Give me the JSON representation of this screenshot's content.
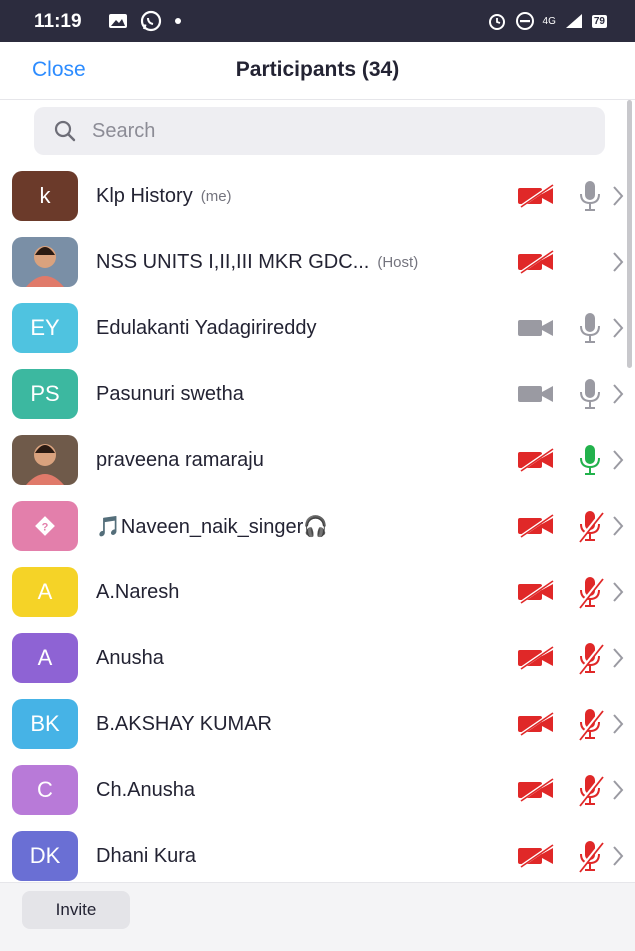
{
  "status_bar": {
    "time": "11:19",
    "signal": "4G",
    "battery": "79"
  },
  "header": {
    "close_label": "Close",
    "title": "Participants (34)"
  },
  "search": {
    "placeholder": "Search"
  },
  "participants": [
    {
      "initials": "k",
      "avatar_color": "#6b3a2a",
      "photo": false,
      "name": "Klp History",
      "suffix": "(me)",
      "video": "off",
      "audio": "on"
    },
    {
      "initials": "",
      "avatar_color": "#7a8fa6",
      "photo": true,
      "name": "NSS UNITS I,II,III MKR GDC...",
      "suffix": "(Host)",
      "video": "off",
      "audio": "none"
    },
    {
      "initials": "EY",
      "avatar_color": "#4fc3e0",
      "photo": false,
      "name": "Edulakanti Yadagirireddy",
      "suffix": "",
      "video": "on",
      "audio": "on"
    },
    {
      "initials": "PS",
      "avatar_color": "#3cb8a0",
      "photo": false,
      "name": "Pasunuri swetha",
      "suffix": "",
      "video": "on",
      "audio": "on"
    },
    {
      "initials": "",
      "avatar_color": "#6f5a4a",
      "photo": true,
      "name": "praveena ramaraju",
      "suffix": "",
      "video": "off",
      "audio": "speaking"
    },
    {
      "initials": "?",
      "avatar_color": "#e37fab",
      "photo": false,
      "name": "🎵Naveen_naik_singer🎧",
      "suffix": "",
      "video": "off",
      "audio": "muted"
    },
    {
      "initials": "A",
      "avatar_color": "#f5d327",
      "photo": false,
      "name": "A.Naresh",
      "suffix": "",
      "video": "off",
      "audio": "muted"
    },
    {
      "initials": "A",
      "avatar_color": "#8e63d4",
      "photo": false,
      "name": "Anusha",
      "suffix": "",
      "video": "off",
      "audio": "muted"
    },
    {
      "initials": "BK",
      "avatar_color": "#46b3e6",
      "photo": false,
      "name": "B.AKSHAY KUMAR",
      "suffix": "",
      "video": "off",
      "audio": "muted"
    },
    {
      "initials": "C",
      "avatar_color": "#b87ad8",
      "photo": false,
      "name": "Ch.Anusha",
      "suffix": "",
      "video": "off",
      "audio": "muted"
    },
    {
      "initials": "DK",
      "avatar_color": "#6a6fd4",
      "photo": false,
      "name": "Dhani Kura",
      "suffix": "",
      "video": "off",
      "audio": "muted"
    }
  ],
  "footer": {
    "invite_label": "Invite"
  },
  "colors": {
    "accent": "#2d8cff",
    "muted_red": "#e02828",
    "speaking_green": "#22b24c",
    "neutral_icon": "#9a9aa2"
  }
}
